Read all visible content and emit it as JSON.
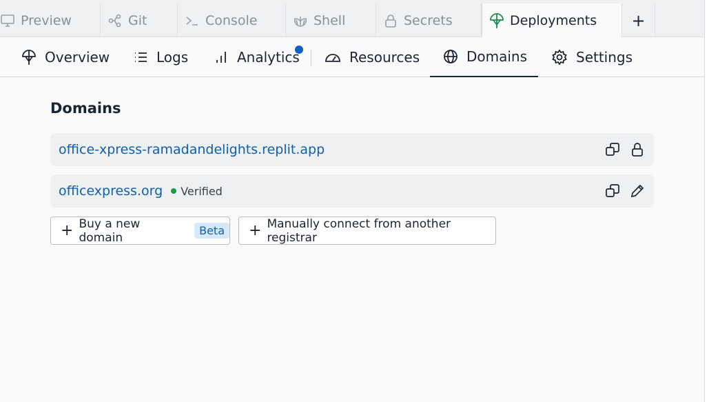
{
  "tabs": [
    {
      "label": "Preview",
      "icon": "monitor-icon"
    },
    {
      "label": "Git",
      "icon": "git-branch-icon"
    },
    {
      "label": "Console",
      "icon": "terminal-icon"
    },
    {
      "label": "Shell",
      "icon": "shell-icon"
    },
    {
      "label": "Secrets",
      "icon": "lock-icon"
    },
    {
      "label": "Deployments",
      "icon": "deploy-icon"
    }
  ],
  "add_tab_label": "+",
  "nav": [
    {
      "label": "Overview",
      "icon": "overview-icon"
    },
    {
      "label": "Logs",
      "icon": "list-icon"
    },
    {
      "label": "Analytics",
      "icon": "bar-chart-icon"
    },
    {
      "label": "Resources",
      "icon": "gauge-icon"
    },
    {
      "label": "Domains",
      "icon": "globe-icon"
    },
    {
      "label": "Settings",
      "icon": "gear-icon"
    }
  ],
  "domains": {
    "title": "Domains",
    "items": [
      {
        "name": "office-xpress-ramadandelights.replit.app"
      },
      {
        "name": "officexpress.org",
        "status": "Verified"
      }
    ],
    "buy_label": "Buy a new domain",
    "buy_badge": "Beta",
    "connect_label": "Manually connect from another registrar"
  },
  "colors": {
    "accent": "#0f5fad",
    "verified": "#1a9e3e",
    "notification": "#0f5fc5"
  }
}
